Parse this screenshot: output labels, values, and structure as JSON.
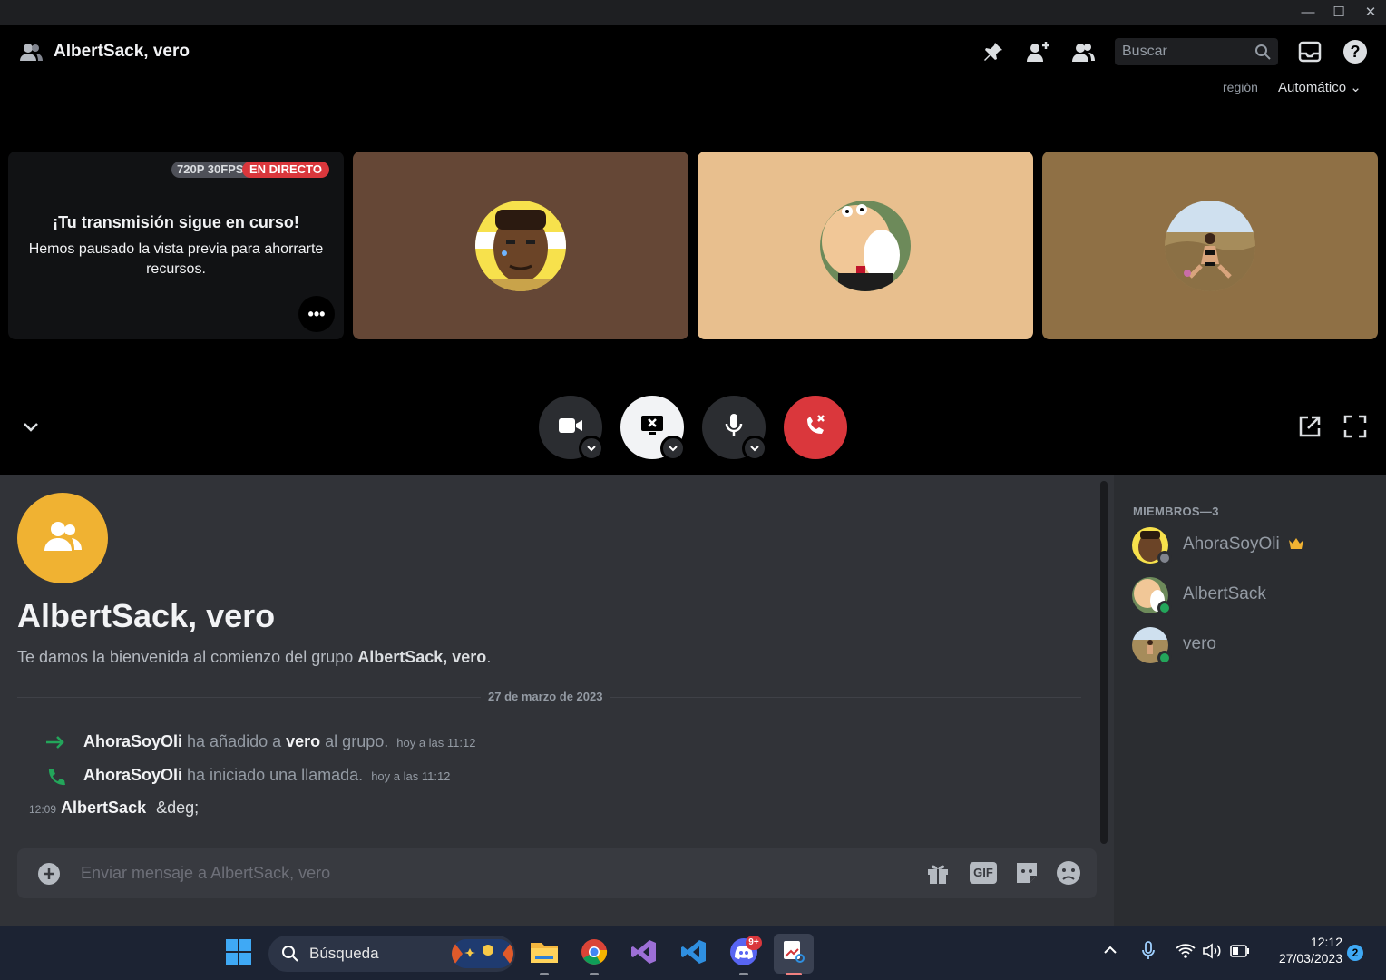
{
  "window": {
    "minimize": "—",
    "maximize": "☐",
    "close": "✕"
  },
  "header": {
    "title": "AlbertSack, vero",
    "search_placeholder": "Buscar",
    "region_label": "región",
    "region_value": "Automático"
  },
  "tiles": {
    "stream_quality": "720P 30FPS",
    "live_badge": "EN DIRECTO",
    "paused_title": "¡Tu transmisión sigue en curso!",
    "paused_body": "Hemos pausado la vista previa para ahorrarte recursos.",
    "colors": [
      "#111214",
      "#654736",
      "#e8bf8e",
      "#8f7045"
    ]
  },
  "chat": {
    "group_title": "AlbertSack, vero",
    "welcome_prefix": "Te damos la bienvenida al comienzo del grupo ",
    "welcome_group": "AlbertSack, vero",
    "welcome_suffix": ".",
    "date_divider": "27 de marzo de 2023",
    "messages": [
      {
        "user": "AhoraSoyOli",
        "text": " ha añadido a ",
        "target": "vero",
        "text2": " al grupo.",
        "time": "hoy a las 11:12"
      },
      {
        "user": "AhoraSoyOli",
        "text": " ha iniciado una llamada.",
        "time": "hoy a las 11:12"
      },
      {
        "time": "12:09",
        "user": "AlbertSack",
        "text": "&deg;"
      }
    ],
    "input_placeholder": "Enviar mensaje a AlbertSack, vero",
    "gif_label": "GIF"
  },
  "members": {
    "header": "MIEMBROS—3",
    "list": [
      {
        "name": "AhoraSoyOli",
        "status": "offline"
      },
      {
        "name": "AlbertSack",
        "status": "online"
      },
      {
        "name": "vero",
        "status": "online"
      }
    ]
  },
  "taskbar": {
    "search_label": "Búsqueda",
    "discord_badge": "9+",
    "time": "12:12",
    "date": "27/03/2023",
    "notif_count": "2"
  },
  "colors": {
    "accent_red": "#da373c",
    "online": "#23a55a",
    "group_yellow": "#f0b232"
  }
}
